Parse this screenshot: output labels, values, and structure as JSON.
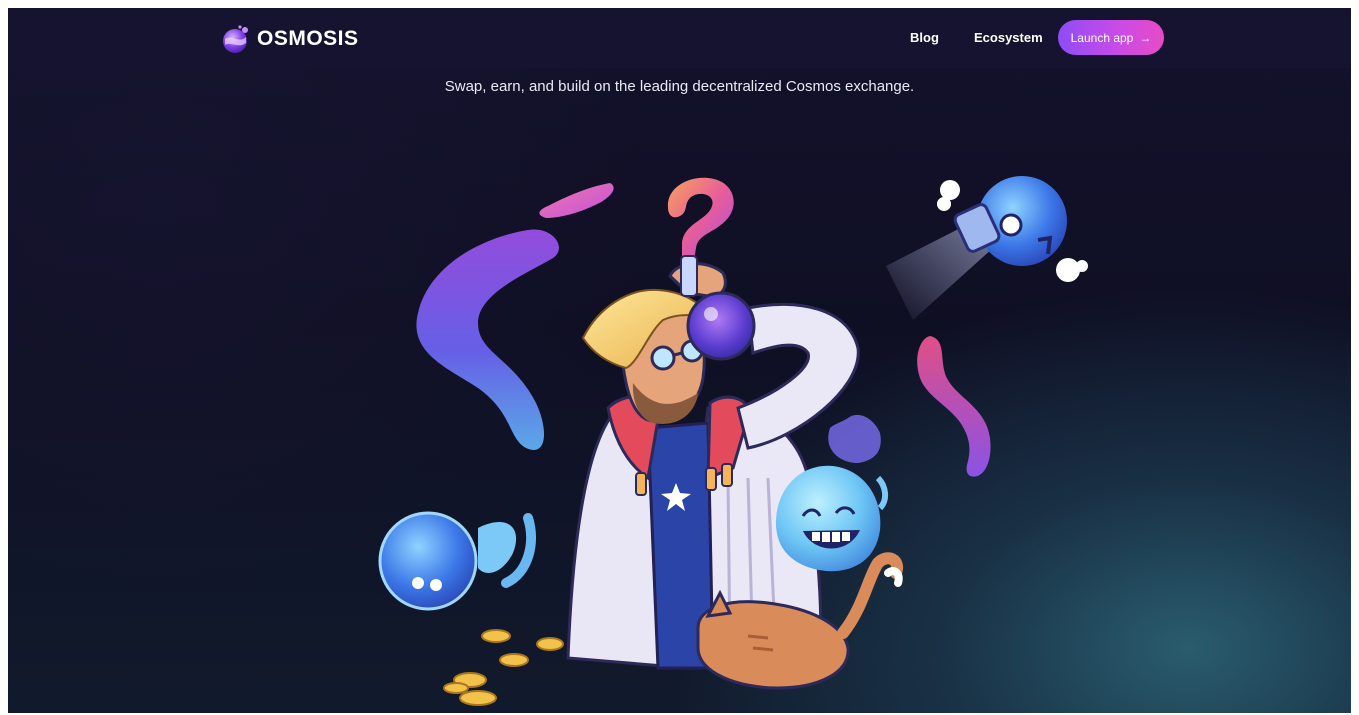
{
  "nav": {
    "brand": "OSMOSIS",
    "links": [
      {
        "label": "Blog"
      },
      {
        "label": "Ecosystem"
      }
    ],
    "cta_label": "Launch app",
    "cta_arrow": "→"
  },
  "hero": {
    "tagline": "Swap, earn, and build on the leading decentralized Cosmos exchange."
  },
  "colors": {
    "nav_bg": "#15132f",
    "cta_start": "#8d4cf6",
    "cta_end": "#e74bc6",
    "teal_glow": "#2e687a"
  },
  "icons": {
    "logo": "osmosis-flask-logo-icon",
    "cta": "arrow-right-icon"
  }
}
